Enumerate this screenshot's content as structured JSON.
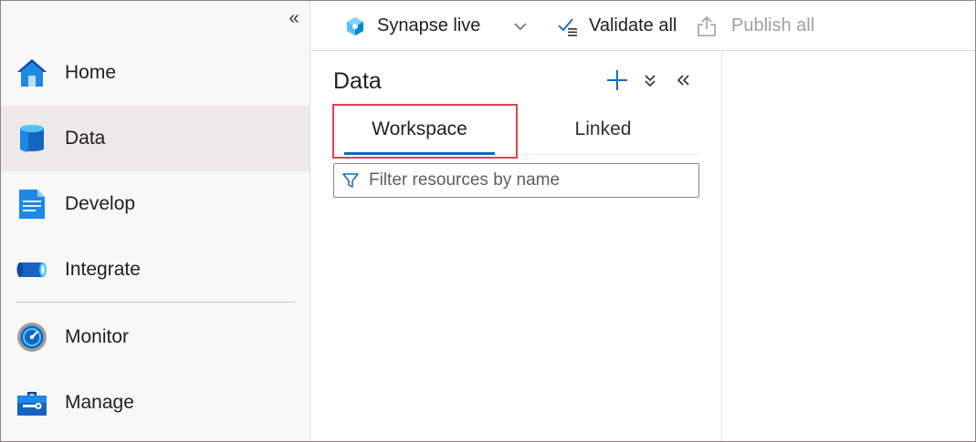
{
  "nav": {
    "collapse_glyph": "«",
    "items": [
      {
        "label": "Home",
        "icon": "home-icon"
      },
      {
        "label": "Data",
        "icon": "database-icon",
        "active": true
      },
      {
        "label": "Develop",
        "icon": "document-icon"
      },
      {
        "label": "Integrate",
        "icon": "pipeline-icon"
      },
      {
        "label": "Monitor",
        "icon": "gauge-icon"
      },
      {
        "label": "Manage",
        "icon": "toolbox-icon"
      }
    ]
  },
  "toolbar": {
    "workspace_label": "Synapse live",
    "validate_label": "Validate all",
    "publish_label": "Publish all"
  },
  "data_panel": {
    "title": "Data",
    "actions": [
      "add-icon",
      "expand-all-icon",
      "collapse-panel-icon"
    ],
    "tabs": [
      {
        "label": "Workspace",
        "selected": true
      },
      {
        "label": "Linked",
        "selected": false
      }
    ],
    "filter_placeholder": "Filter resources by name"
  },
  "colors": {
    "accent": "#0f6cbd",
    "highlight": "#e0424b",
    "nav_background": "#f8f8f8",
    "nav_active": "#ebeae9"
  }
}
